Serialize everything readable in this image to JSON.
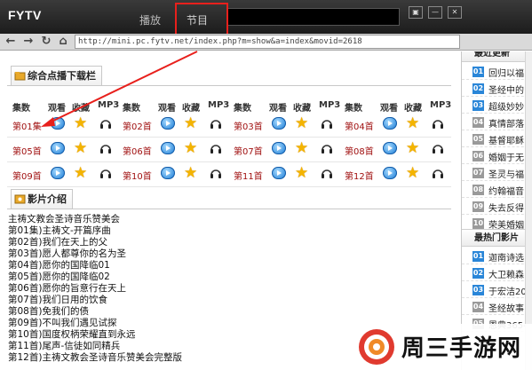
{
  "window": {
    "logo": "FYTV",
    "tabs": [
      "播放",
      "节目"
    ],
    "search_value": "",
    "buttons": [
      "▣",
      "—",
      "✕"
    ]
  },
  "address_bar": {
    "url": "http://mini.pc.fytv.net/index.php?m=show&a=index&movid=2618"
  },
  "download_section": {
    "tab_label": "综合点播下载栏",
    "columns": [
      "集数",
      "观看",
      "收藏",
      "MP3"
    ],
    "rows": [
      [
        "第01集",
        "第02首",
        "第03首",
        "第04首"
      ],
      [
        "第05首",
        "第06首",
        "第07首",
        "第08首"
      ],
      [
        "第09首",
        "第10首",
        "第11首",
        "第12首"
      ]
    ]
  },
  "intro_section": {
    "tab_label": "影片介绍",
    "lines": [
      "主祷文教会圣诗音乐赞美会",
      "第01集)主祷文-开篇序曲",
      "第02首)我们在天上的父",
      "第03首)愿人都尊你的名为圣",
      "第04首)愿你的国降临01",
      "第05首)愿你的国降临02",
      "第06首)愿你的旨意行在天上",
      "第07首)我们日用的饮食",
      "第08首)免我们的债",
      "第09首)不叫我们遇见试探",
      "第10首)国度权柄荣耀直到永远",
      "第11首)尾声-信徒如同精兵",
      "第12首)主祷文教会圣诗音乐赞美会完整版"
    ]
  },
  "sidebar": {
    "top_title": "最近更新",
    "top_items": [
      {
        "num": "01",
        "text": "回归以福",
        "hot": true
      },
      {
        "num": "02",
        "text": "圣经中的",
        "hot": true
      },
      {
        "num": "03",
        "text": "超级妙妙",
        "hot": true
      },
      {
        "num": "04",
        "text": "真情部落",
        "hot": false
      },
      {
        "num": "05",
        "text": "基督耶稣",
        "hot": false
      },
      {
        "num": "06",
        "text": "婚姻于无",
        "hot": false
      },
      {
        "num": "07",
        "text": "圣灵与福",
        "hot": false
      },
      {
        "num": "08",
        "text": "约翰福音",
        "hot": false
      },
      {
        "num": "09",
        "text": "失去反得",
        "hot": false
      },
      {
        "num": "10",
        "text": "荣美婚姻",
        "hot": false
      }
    ],
    "bottom_title": "最热门影片",
    "bottom_items": [
      {
        "num": "01",
        "text": "迦南诗选",
        "hot": true
      },
      {
        "num": "02",
        "text": "大卫赖森",
        "hot": true
      },
      {
        "num": "03",
        "text": "于宏洁20",
        "hot": true
      },
      {
        "num": "04",
        "text": "圣经故事",
        "hot": false
      },
      {
        "num": "05",
        "text": "恩典365-",
        "hot": false
      }
    ]
  },
  "watermark": {
    "text": "周三手游网"
  },
  "colors": {
    "annotation": "#e8201c",
    "episode_label": "#a01010",
    "rank_hot": "#2a86d8"
  }
}
